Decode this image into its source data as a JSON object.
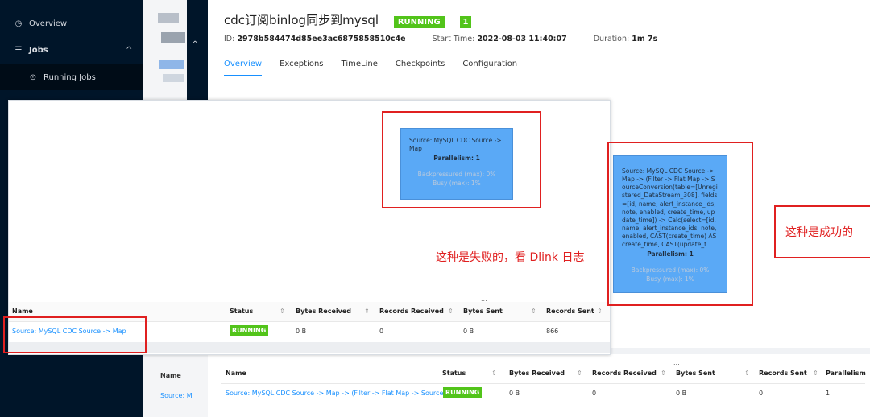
{
  "sidebar": {
    "items": [
      {
        "icon": "dashboard-icon",
        "label": "Overview"
      },
      {
        "icon": "list-icon",
        "label": "Jobs"
      },
      {
        "icon": "play-circle-icon",
        "label": "Running Jobs"
      }
    ],
    "jobs_chevron": "^"
  },
  "job": {
    "title": "cdc订阅binlog同步到mysql",
    "status": "RUNNING",
    "count": "1",
    "id_label": "ID:",
    "id": "2978b584474d85ee3ac6875858510c4e",
    "start_label": "Start Time:",
    "start_time": "2022-08-03 11:40:07",
    "duration_label": "Duration:",
    "duration": "1m 7s"
  },
  "tabs": [
    "Overview",
    "Exceptions",
    "TimeLine",
    "Checkpoints",
    "Configuration"
  ],
  "node_failed": {
    "name": "Source: MySQL CDC Source -> Map",
    "parallelism": "Parallelism: 1",
    "backpressure": "Backpressured (max): 0%",
    "busy": "Busy (max): 1%"
  },
  "node_success": {
    "name": "Source: MySQL CDC Source -> Map -> (Filter -> Flat Map -> SourceConversion(table=[Unregistered_DataStream_308], fields=[id, name, alert_instance_ids, note, enabled, create_time, update_time]) -> Calc(select=[id, name, alert_instance_ids, note, enabled, CAST(create_time) AS create_time, CAST(update_t...",
    "parallelism": "Parallelism: 1",
    "backpressure": "Backpressured (max): 0%",
    "busy": "Busy (max): 1%"
  },
  "panel_table": {
    "columns": [
      "Name",
      "Status",
      "Bytes Received",
      "Records Received",
      "Bytes Sent",
      "Records Sent"
    ],
    "row": {
      "name": "Source: MySQL CDC Source -> Map",
      "status": "RUNNING",
      "bytes_received": "0 B",
      "records_received": "0",
      "bytes_sent": "0 B",
      "records_sent": "866"
    }
  },
  "bottom_table": {
    "columns": [
      "Name",
      "Status",
      "Bytes Received",
      "Records Received",
      "Bytes Sent",
      "Records Sent",
      "Parallelism"
    ],
    "row": {
      "name": "Source: MySQL CDC Source -> Map -> (Filter -> Flat Map -> SourceC...",
      "status": "RUNNING",
      "bytes_received": "0 B",
      "records_received": "0",
      "bytes_sent": "0 B",
      "records_sent": "0",
      "parallelism": "1"
    }
  },
  "left_bottom": {
    "name_header": "Name",
    "name_value": "Source: M"
  },
  "annotations": {
    "failed": "这种是失败的，看 Dlink 日志",
    "success": "这种是成功的"
  },
  "sort_glyph": "⇕",
  "more_glyph": "...",
  "colors": {
    "sidebar": "#001529",
    "accent": "#1890ff",
    "running": "#52c41a",
    "node": "#5aa9f6",
    "annotation": "#e02020"
  }
}
